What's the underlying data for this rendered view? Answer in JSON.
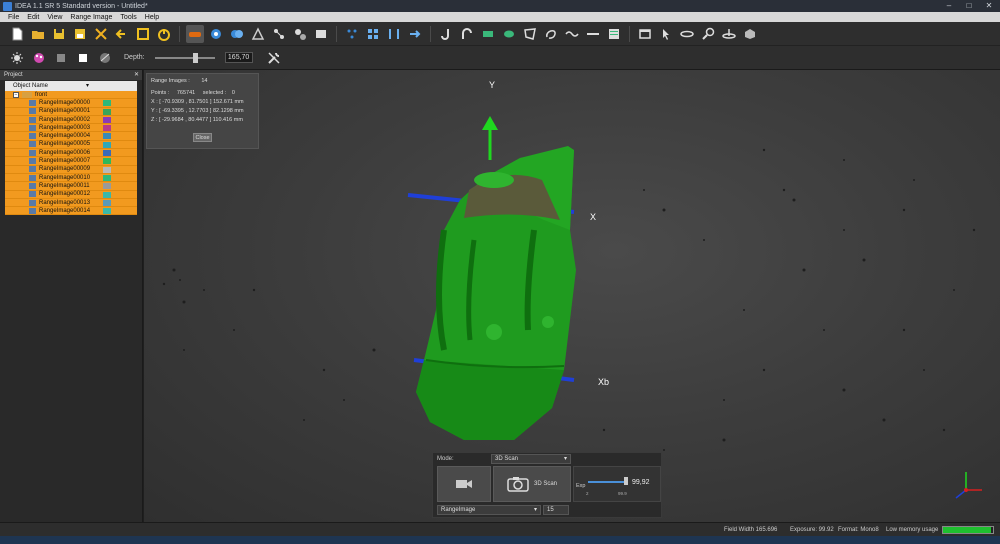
{
  "window": {
    "title": "IDEA 1.1 SR 5 Standard version - Untitled*"
  },
  "menu": [
    "File",
    "Edit",
    "View",
    "Range Image",
    "Tools",
    "Help"
  ],
  "toolbar": {
    "depth_label": "Depth:",
    "depth_value": "165,70",
    "depth_fraction": 0.63
  },
  "project": {
    "panel_title": "Project",
    "column_header": "Object Name",
    "root": "front",
    "items": [
      {
        "label": "RangeImage00000",
        "color": "#2fb87a"
      },
      {
        "label": "RangeImage00001",
        "color": "#3aa55a"
      },
      {
        "label": "RangeImage00002",
        "color": "#8a3ab8"
      },
      {
        "label": "RangeImage00003",
        "color": "#b83a8a"
      },
      {
        "label": "RangeImage00004",
        "color": "#3a8ab8"
      },
      {
        "label": "RangeImage00005",
        "color": "#2fa8b8"
      },
      {
        "label": "RangeImage00006",
        "color": "#3a6ab8"
      },
      {
        "label": "RangeImage00007",
        "color": "#2fb85a"
      },
      {
        "label": "RangeImage00009",
        "color": "#b8b8b8"
      },
      {
        "label": "RangeImage00010",
        "color": "#2fb87a"
      },
      {
        "label": "RangeImage00011",
        "color": "#9a9a9a"
      },
      {
        "label": "RangeImage00012",
        "color": "#3ab8a8"
      },
      {
        "label": "RangeImage00013",
        "color": "#5a9ab8"
      },
      {
        "label": "RangeImage00014",
        "color": "#3ab8a8"
      }
    ]
  },
  "info": {
    "range_images_label": "Range Images :",
    "range_images_value": "14",
    "points_label": "Points :",
    "points_value": "765741",
    "selected_label": "selected :",
    "selected_value": "0",
    "x_line": "X : [ -70.9309 , 81.7501 ]   152.671 mm",
    "y_line": "Y : [ -69.3395 , 12.7703 ]   82.1298 mm",
    "z_line": "Z : [ -29.9684 , 80.4477 ]   110.416 mm",
    "close_label": "Close"
  },
  "viewport": {
    "label_y": "Y",
    "label_x": "X",
    "label_xb": "Xb"
  },
  "scan": {
    "mode_label": "Mode:",
    "mode_value": "3D Scan",
    "scan_button": "3D Scan",
    "exp_label": "Exp",
    "exp_value": "99,92",
    "exp_fraction": 0.95,
    "exp_min": "2",
    "exp_max": "99.9",
    "type_value": "RangeImage",
    "count_value": "15"
  },
  "status": {
    "field_width": "Field Width 165.696",
    "exposure": "Exposure: 99.92",
    "format": "Format: Mono8",
    "memory": "Low memory usage",
    "memory_fraction": 0.95
  },
  "colors": {
    "accent": "#f29a1f",
    "mesh": "#1f9b1f",
    "scan_active": "#4a90d9"
  }
}
